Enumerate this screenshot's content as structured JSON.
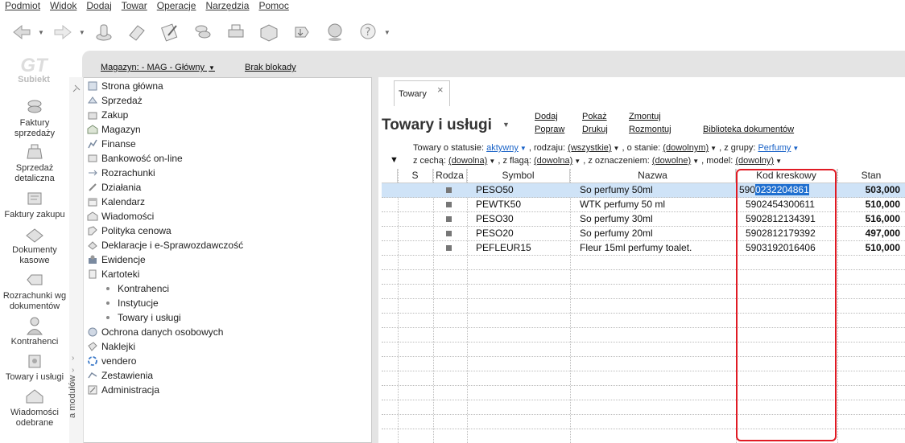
{
  "menu": [
    "Podmiot",
    "Widok",
    "Dodaj",
    "Towar",
    "Operacje",
    "Narzędzia",
    "Pomoc"
  ],
  "logo_text": "Subiekt",
  "modules": [
    "Faktury sprzedaży",
    "Sprzedaż detaliczna",
    "Faktury zakupu",
    "Dokumenty kasowe",
    "Rozrachunki wg dokumentów",
    "Kontrahenci",
    "Towary i usługi",
    "Wiadomości odebrane"
  ],
  "header": {
    "magazyn": "Magazyn: - MAG - Główny",
    "blokada": "Brak blokady"
  },
  "nav": {
    "side_label": "a modułów",
    "items": [
      "Strona główna",
      "Sprzedaż",
      "Zakup",
      "Magazyn",
      "Finanse",
      "Bankowość on-line",
      "Rozrachunki",
      "Działania",
      "Kalendarz",
      "Wiadomości",
      "Polityka cenowa",
      "Deklaracje i e-Sprawozdawczość",
      "Ewidencje",
      "Kartoteki"
    ],
    "sub_items": [
      "Kontrahenci",
      "Instytucje",
      "Towary i usługi"
    ],
    "items_after": [
      "Ochrona danych osobowych",
      "Naklejki",
      "vendero",
      "Zestawienia",
      "Administracja"
    ]
  },
  "tab": {
    "label": "Towary",
    "close": "×"
  },
  "page": {
    "title": "Towary i usługi",
    "actions": [
      "Dodaj",
      "Popraw",
      "Pokaż",
      "Drukuj",
      "Zmontuj",
      "Rozmontuj",
      "Biblioteka dokumentów"
    ]
  },
  "filters": {
    "status_label": "Towary o statusie:",
    "status_value": "aktywny",
    "rodzaj_label": ", rodzaju:",
    "rodzaj_value": "(wszystkie)",
    "stan_label": ", o stanie:",
    "stan_value": "(dowolnym)",
    "grupa_label": ", z grupy:",
    "grupa_value": "Perfumy",
    "cecha_label": "z cechą:",
    "cecha_value": "(dowolna)",
    "flaga_label": ", z flagą:",
    "flaga_value": "(dowolna)",
    "oznaczenie_label": ", z oznaczeniem:",
    "oznaczenie_value": "(dowolne)",
    "model_label": ", model:",
    "model_value": "(dowolny)"
  },
  "grid": {
    "columns": [
      "S",
      "Rodza",
      "Symbol",
      "Nazwa",
      "Kod kreskowy",
      "Stan"
    ],
    "rows": [
      {
        "symbol": "PESO50",
        "nazwa": "So perfumy 50ml",
        "kod_pre": "590",
        "kod_sel": "0232204861",
        "stan": "503,000"
      },
      {
        "symbol": "PEWTK50",
        "nazwa": "WTK perfumy 50 ml",
        "kod": "5902454300611",
        "stan": "510,000"
      },
      {
        "symbol": "PESO30",
        "nazwa": "So perfumy 30ml",
        "kod": "5902812134391",
        "stan": "516,000"
      },
      {
        "symbol": "PESO20",
        "nazwa": "So perfumy 20ml",
        "kod": "5902812179392",
        "stan": "497,000"
      },
      {
        "symbol": "PEFLEUR15",
        "nazwa": "Fleur 15ml perfumy toalet.",
        "kod": "5903192016406",
        "stan": "510,000"
      }
    ]
  },
  "colors": {
    "highlight": "#1f6fcf",
    "selected_row": "#cfe3f7",
    "annotation": "#e01b24",
    "link_blue": "#1a63c7"
  }
}
